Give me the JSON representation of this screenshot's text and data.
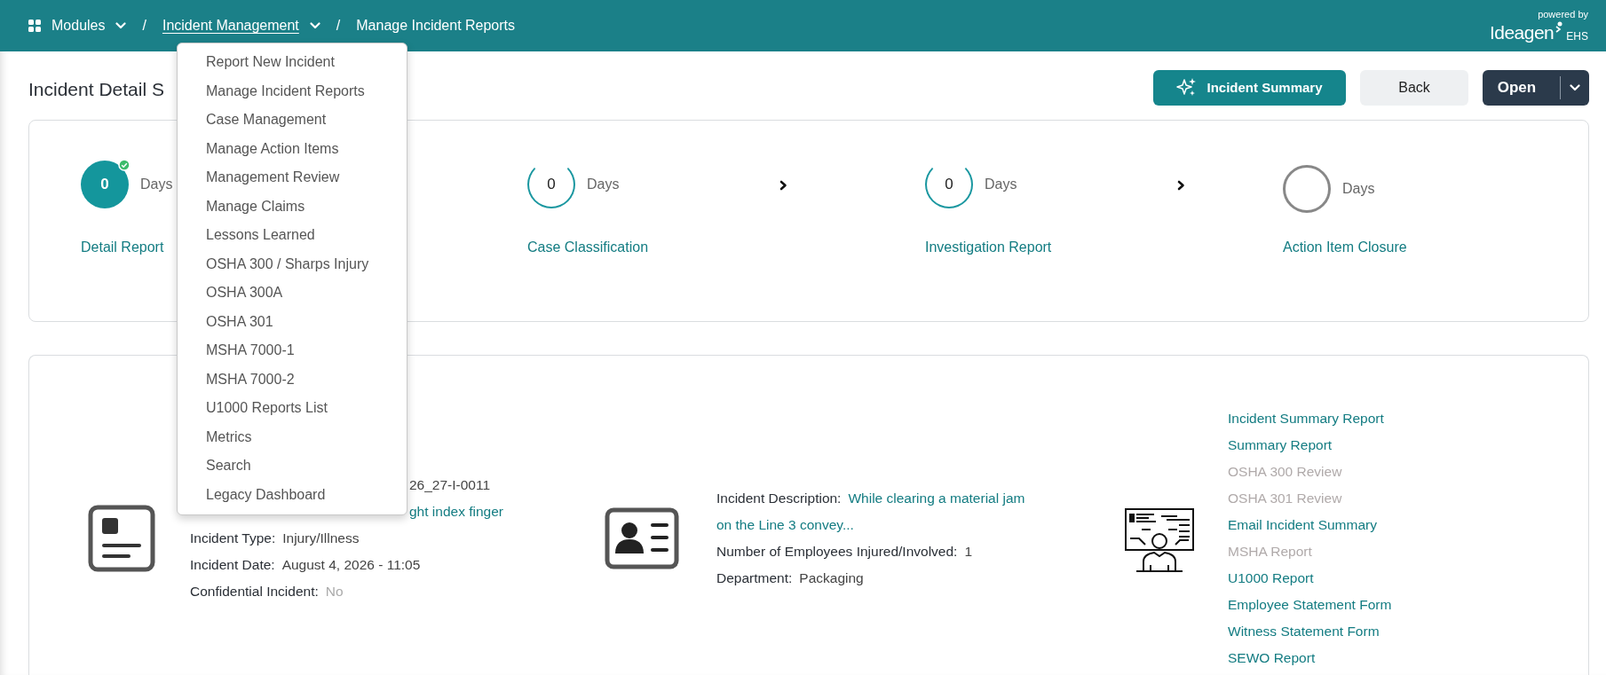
{
  "breadcrumb": [
    {
      "kind": "modules",
      "label": "Modules",
      "expanded": false
    },
    {
      "kind": "menu",
      "separator": "/",
      "label": "Incident Management",
      "expanded": true
    },
    {
      "kind": "current",
      "separator": "/",
      "label": "Manage Incident Reports",
      "expanded": false
    }
  ],
  "logo": {
    "tagline": "powered by",
    "brand": "Ideagen",
    "suffix": "EHS"
  },
  "menu": {
    "items": [
      "Report New Incident",
      "Manage Incident Reports",
      "Case Management",
      "Manage Action Items",
      "Management Review",
      "Manage Claims",
      "Lessons Learned",
      "OSHA 300 / Sharps Injury",
      "OSHA 300A",
      "OSHA 301",
      "MSHA 7000-1",
      "MSHA 7000-2",
      "U1000 Reports List",
      "Metrics",
      "Search",
      "Legacy Dashboard"
    ]
  },
  "page_title": "Incident Detail S",
  "actions": [
    {
      "kind": "ai",
      "label": "Incident Summary"
    },
    {
      "kind": "secondary",
      "label": "Back"
    },
    {
      "kind": "split",
      "label": "Open"
    }
  ],
  "stages": [
    {
      "kind": "done",
      "count": "0",
      "unit": "Days",
      "label": "Detail Report",
      "arrow": false
    },
    {
      "kind": "active",
      "count": "0",
      "unit": "Days",
      "label": "Case Classification",
      "arrow": true
    },
    {
      "kind": "active",
      "count": "0",
      "unit": "Days",
      "label": "Investigation Report",
      "arrow": true
    },
    {
      "kind": "pending",
      "unit": "Days",
      "label": "Action Item Closure",
      "arrow": false
    }
  ],
  "incident": {
    "fields": [
      {
        "kind": "partial",
        "value": "26_27-I-0011",
        "link": false,
        "muted": false
      },
      {
        "kind": "partial",
        "value": "ght index finger",
        "link": true,
        "muted": false
      },
      {
        "kind": "field",
        "label": "Incident Type:",
        "value": "Injury/Illness",
        "link": false,
        "muted": false
      },
      {
        "kind": "field",
        "label": "Incident Date:",
        "value": "August 4, 2026 - 11:05",
        "link": false,
        "muted": false
      },
      {
        "kind": "field",
        "label": "Confidential Incident:",
        "value": "No",
        "link": false,
        "muted": true
      }
    ]
  },
  "people": {
    "fields": [
      {
        "kind": "field",
        "label": "Incident Description:",
        "value": "While clearing a material jam",
        "link": true,
        "muted": false
      },
      {
        "kind": "continued",
        "value": "on the Line 3 convey...",
        "link": true,
        "muted": false
      },
      {
        "kind": "field",
        "label": "Number of Employees Injured/Involved:",
        "value": "1",
        "link": false,
        "muted": false
      },
      {
        "kind": "field",
        "label": "Department:",
        "value": "Packaging",
        "link": false,
        "muted": false
      }
    ]
  },
  "reports": [
    {
      "label": "Incident Summary Report",
      "disabled": false
    },
    {
      "label": "Summary Report",
      "disabled": false
    },
    {
      "label": "OSHA 300 Review",
      "disabled": true
    },
    {
      "label": "OSHA 301 Review",
      "disabled": true
    },
    {
      "label": "Email Incident Summary",
      "disabled": false
    },
    {
      "label": "MSHA Report",
      "disabled": true
    },
    {
      "label": "U1000 Report",
      "disabled": false
    },
    {
      "label": "Employee Statement Form",
      "disabled": false
    },
    {
      "label": "Witness Statement Form",
      "disabled": false
    },
    {
      "label": "SEWO Report",
      "disabled": false
    }
  ]
}
